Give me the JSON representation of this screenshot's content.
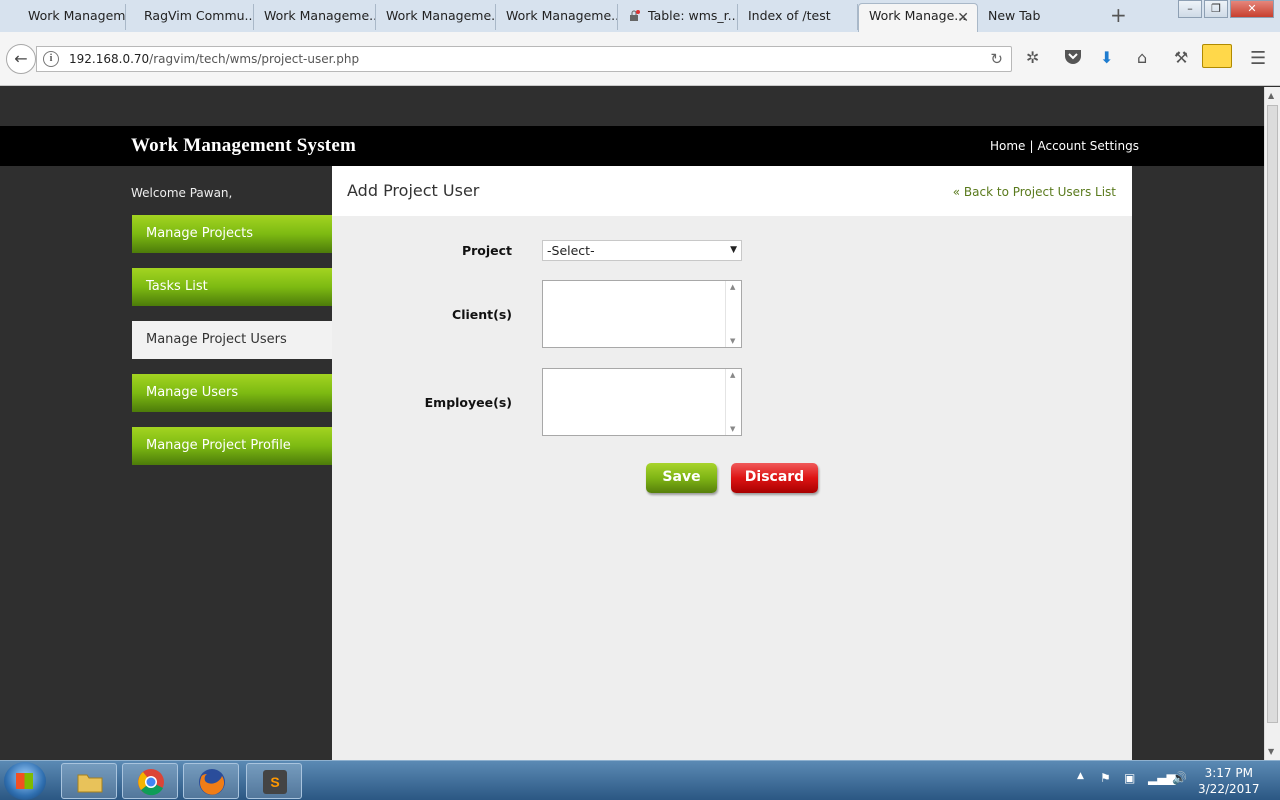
{
  "browser": {
    "tabs": [
      {
        "label": "Work Manageme...",
        "active": false
      },
      {
        "label": "RagVim Commu...",
        "active": false
      },
      {
        "label": "Work Manageme...",
        "active": false
      },
      {
        "label": "Work Manageme...",
        "active": false
      },
      {
        "label": "Work Manageme...",
        "active": false
      },
      {
        "label": "Table: wms_r...",
        "active": false
      },
      {
        "label": "Index of /test",
        "active": false
      },
      {
        "label": "Work Manage...",
        "active": true
      },
      {
        "label": "New Tab",
        "active": false
      }
    ],
    "url_host": "192.168.0.70",
    "url_path": "/ragvim/tech/wms/project-user.php"
  },
  "header": {
    "title": "Work Management System",
    "home": "Home",
    "separator": "|",
    "account_settings": "Account Settings"
  },
  "sidebar": {
    "welcome": "Welcome Pawan,",
    "items": [
      {
        "label": "Manage Projects",
        "active": false
      },
      {
        "label": "Tasks List",
        "active": false
      },
      {
        "label": "Manage Project Users",
        "active": true
      },
      {
        "label": "Manage Users",
        "active": false
      },
      {
        "label": "Manage Project Profile",
        "active": false
      }
    ]
  },
  "main": {
    "title": "Add Project User",
    "back_link": "« Back to Project Users List",
    "form": {
      "project_label": "Project",
      "project_value": "-Select-",
      "clients_label": "Client(s)",
      "employees_label": "Employee(s)",
      "save": "Save",
      "discard": "Discard"
    }
  },
  "taskbar": {
    "time": "3:17 PM",
    "date": "3/22/2017"
  },
  "colors": {
    "menu_green": "#7dba12",
    "discard_red": "#dd1414",
    "back_link": "#5a7a1d",
    "header_bg": "#000000"
  }
}
